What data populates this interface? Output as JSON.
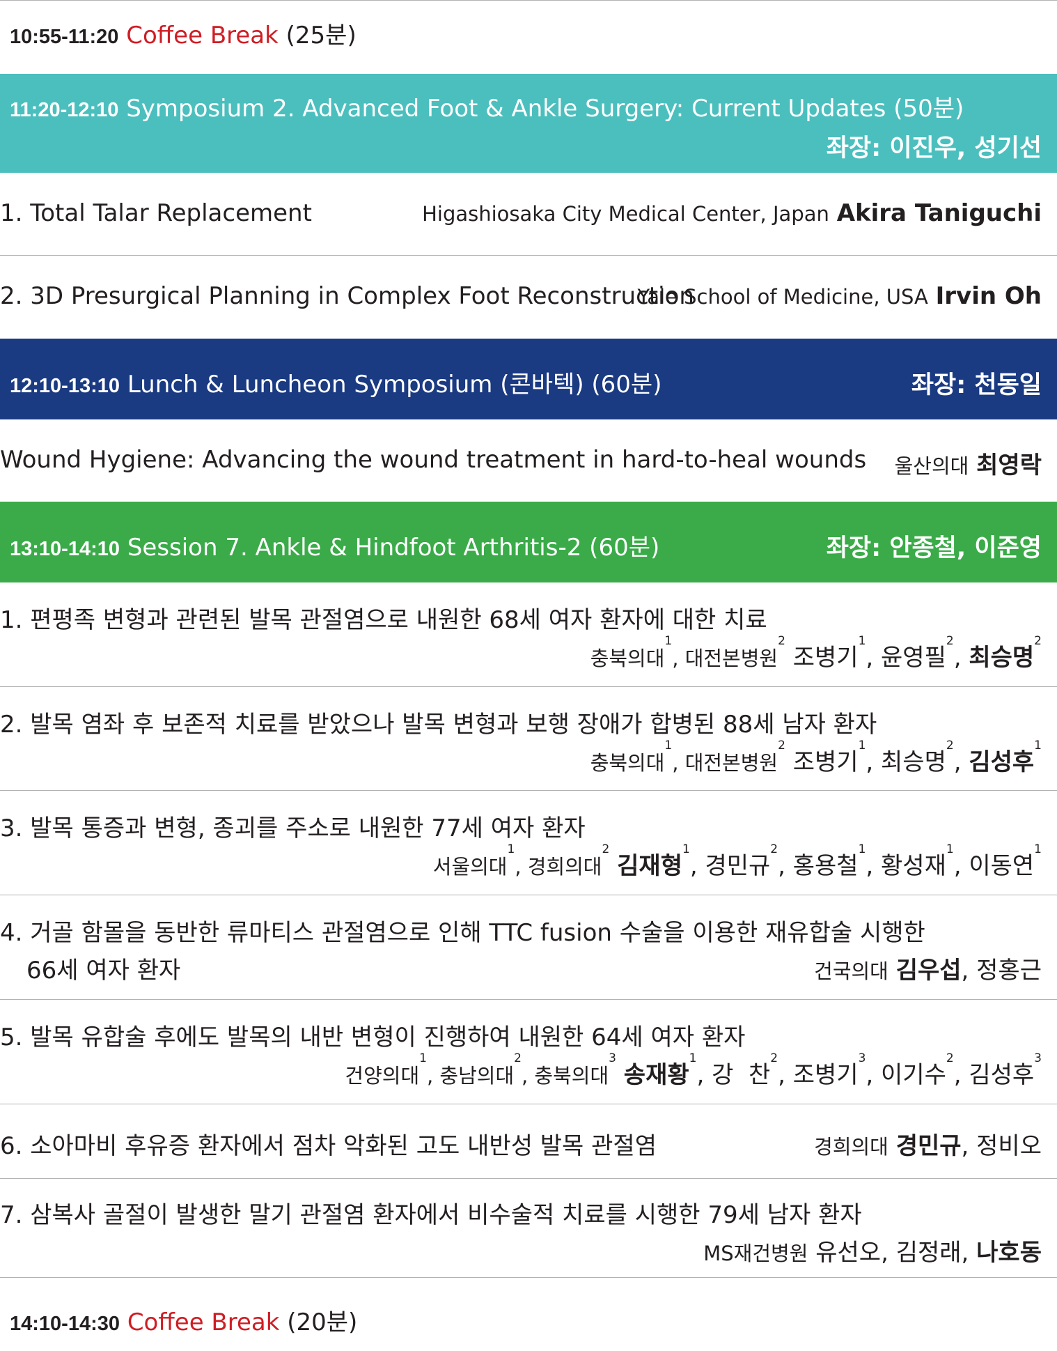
{
  "coffee1": {
    "time": "10:55-11:20",
    "label": "Coffee Break",
    "duration": "(25분)"
  },
  "sym2": {
    "time": "11:20-12:10",
    "title": "Symposium 2. Advanced Foot & Ankle Surgery: Current Updates (50분)",
    "chair": "좌장: 이진우, 성기선",
    "color": "#4bbfbe",
    "talks": [
      {
        "title": "1. Total Talar Replacement",
        "affiliation": "Higashiosaka City Medical Center, Japan",
        "speaker": "Akira Taniguchi"
      },
      {
        "title": "2. 3D Presurgical Planning in Complex Foot Reconstruction",
        "affiliation": "Yale School of Medicine, USA",
        "speaker": "Irvin Oh"
      }
    ]
  },
  "lunch": {
    "time": "12:10-13:10",
    "title": "Lunch & Luncheon Symposium (콘바텍) (60분)",
    "chair": "좌장: 천동일",
    "color": "#1a3a82",
    "talk": {
      "title": "Wound Hygiene: Advancing the wound treatment in hard-to-heal wounds",
      "affiliation": "울산의대",
      "speaker": "최영락"
    }
  },
  "session7": {
    "time": "13:10-14:10",
    "title": "Session 7. Ankle & Hindfoot Arthritis-2 (60분)",
    "chair": "좌장: 안종철, 이준영",
    "color": "#3aab48",
    "talks": [
      {
        "title": "1. 편평족 변형과 관련된 발목 관절염으로 내원한 68세 여자 환자에 대한 치료",
        "aff1": "충북의대",
        "aff1_sup": "1",
        "aff2": "대전본병원",
        "aff2_sup": "2",
        "a1": "조병기",
        "a1_sup": "1",
        "a2": "윤영필",
        "a2_sup": "2",
        "a3": "최승명",
        "a3_sup": "2"
      },
      {
        "title": "2. 발목 염좌 후 보존적 치료를 받았으나 발목 변형과 보행 장애가 합병된 88세 남자 환자",
        "aff1": "충북의대",
        "aff1_sup": "1",
        "aff2": "대전본병원",
        "aff2_sup": "2",
        "a1": "조병기",
        "a1_sup": "1",
        "a2": "최승명",
        "a2_sup": "2",
        "a3": "김성후",
        "a3_sup": "1"
      },
      {
        "title": "3. 발목 통증과 변형, 종괴를 주소로 내원한 77세 여자 환자",
        "aff1": "서울의대",
        "aff1_sup": "1",
        "aff2": "경희의대",
        "aff2_sup": "2",
        "a1": "김재형",
        "a1_sup": "1",
        "a2": "경민규",
        "a2_sup": "2",
        "a3": "홍용철",
        "a3_sup": "1",
        "a4": "황성재",
        "a4_sup": "1",
        "a5": "이동연",
        "a5_sup": "1"
      },
      {
        "title": "4. 거골 함몰을 동반한 류마티스 관절염으로 인해 TTC fusion 수술을 이용한 재유합술 시행한",
        "title2": "66세 여자 환자",
        "aff1": "건국의대",
        "a1": "김우섭",
        "a2": "정홍근"
      },
      {
        "title": "5. 발목 유합술 후에도 발목의 내반 변형이 진행하여 내원한 64세 여자 환자",
        "aff1": "건양의대",
        "aff1_sup": "1",
        "aff2": "충남의대",
        "aff2_sup": "2",
        "aff3": "충북의대",
        "aff3_sup": "3",
        "a1": "송재황",
        "a1_sup": "1",
        "a2": "강  찬",
        "a2_sup": "2",
        "a3": "조병기",
        "a3_sup": "3",
        "a4": "이기수",
        "a4_sup": "2",
        "a5": "김성후",
        "a5_sup": "3"
      },
      {
        "title": "6. 소아마비 후유증 환자에서 점차 악화된 고도 내반성 발목 관절염",
        "aff1": "경희의대",
        "a1": "경민규",
        "a2": "정비오"
      },
      {
        "title": "7. 삼복사 골절이 발생한 말기 관절염 환자에서 비수술적 치료를 시행한 79세 남자 환자",
        "aff1": "MS재건병원",
        "a1": "유선오",
        "a2": "김정래",
        "a3": "나호동"
      }
    ]
  },
  "coffee2": {
    "time": "14:10-14:30",
    "label": "Coffee Break",
    "duration": "(20분)"
  }
}
